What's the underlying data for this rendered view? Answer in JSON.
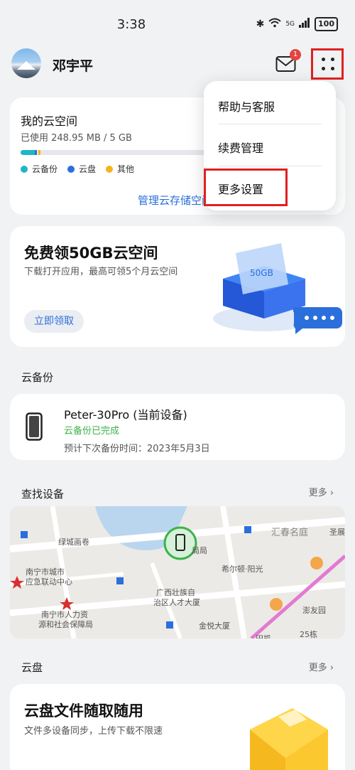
{
  "status": {
    "time": "3:38",
    "battery": "100",
    "network": "5G"
  },
  "header": {
    "username": "邓宇平",
    "mail_badge": "1"
  },
  "storage": {
    "title": "我的云空间",
    "used_text": "已使用 248.95 MB / 5 GB",
    "legend": [
      {
        "label": "云备份",
        "color": "#1fb6c6"
      },
      {
        "label": "云盘",
        "color": "#2a6fdc"
      },
      {
        "label": "其他",
        "color": "#f3b51b"
      }
    ],
    "manage_link": "管理云存储空间"
  },
  "promo": {
    "title": "免费领50GB云空间",
    "desc": "下载打开应用，最高可领5个月云空间",
    "button": "立即领取",
    "badge": "50GB"
  },
  "backup_section": {
    "title": "云备份",
    "device_name": "Peter-30Pro (当前设备)",
    "status": "云备份已完成",
    "next": "预计下次备份时间：2023年5月3日"
  },
  "find_section": {
    "title": "查找设备",
    "more": "更多",
    "map_labels": [
      "绿城画卷",
      "汇春名庭",
      "圣展",
      "南宁市城市",
      "应急联动中心",
      "局局",
      "希尔顿·阳光",
      "广西壮族自",
      "治区人才大厦",
      "南宁市人力资",
      "源和社会保障局",
      "金悦大厦",
      "澎友园",
      "25栋",
      "田凯"
    ]
  },
  "disk_section": {
    "title": "云盘",
    "more": "更多",
    "card_title": "云盘文件随取随用",
    "card_desc": "文件多设备同步，上传下载不限速"
  },
  "dropdown": {
    "items": [
      "帮助与客服",
      "续费管理",
      "更多设置"
    ]
  }
}
